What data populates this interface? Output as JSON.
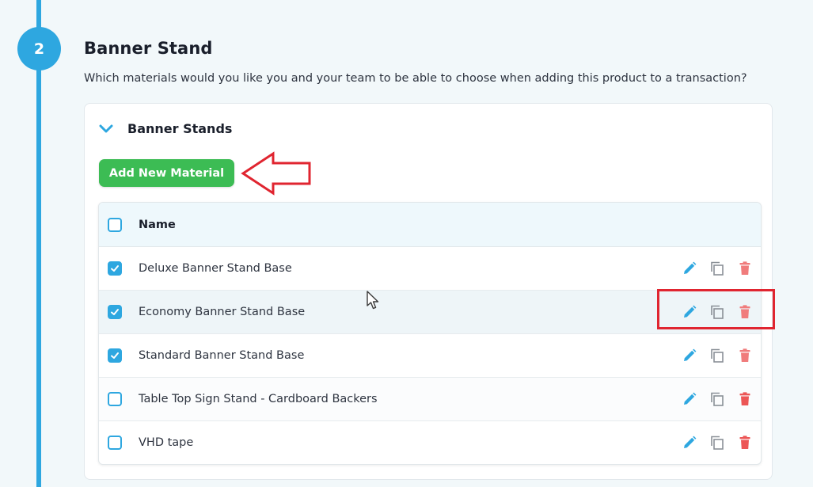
{
  "step": {
    "number": "2",
    "title": "Banner Stand",
    "subtitle": "Which materials would you like you and your team to be able to choose when adding this product to a transaction?"
  },
  "group": {
    "title": "Banner Stands",
    "expanded": true,
    "add_button_label": "Add New Material"
  },
  "table": {
    "column_name": "Name",
    "rows": [
      {
        "name": "Deluxe Banner Stand Base",
        "checked": true
      },
      {
        "name": "Economy Banner Stand Base",
        "checked": true
      },
      {
        "name": "Standard Banner Stand Base",
        "checked": true
      },
      {
        "name": "Table Top Sign Stand - Cardboard Backers",
        "checked": false
      },
      {
        "name": "VHD tape",
        "checked": false
      }
    ],
    "actions": [
      "pencil-icon",
      "copy-icon",
      "trash-icon"
    ]
  },
  "colors": {
    "accent": "#2ea7e0",
    "add_button": "#3cbc54",
    "delete": "#f07c7c",
    "delete_strong": "#ec5656",
    "annotation": "#e02530"
  }
}
